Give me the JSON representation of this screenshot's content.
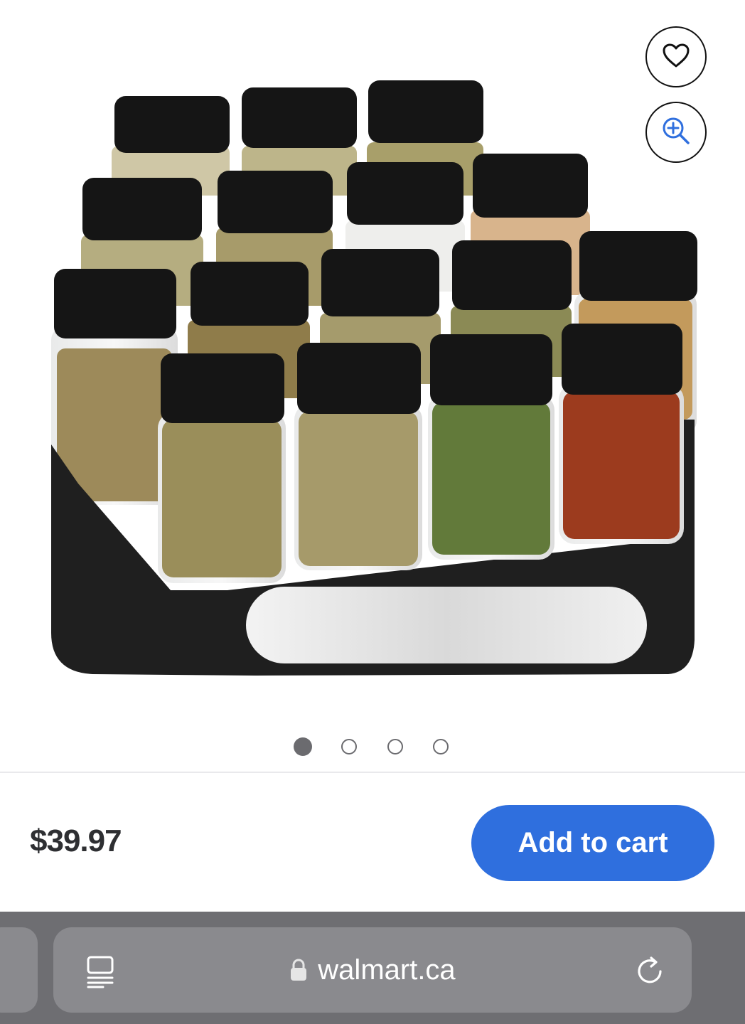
{
  "product": {
    "price": "$39.97",
    "add_to_cart_label": "Add to cart",
    "image_alt": "Spice rack with 16 glass spice jars with black lids",
    "carousel": {
      "total": 4,
      "active_index": 0
    }
  },
  "icons": {
    "favorite": "heart-icon",
    "zoom": "zoom-in-icon",
    "reader": "reader-mode-icon",
    "lock": "lock-icon",
    "reload": "reload-icon"
  },
  "browser": {
    "url": "walmart.ca"
  },
  "colors": {
    "accent": "#2f6fde",
    "price_text": "#2e2f32",
    "toolbar": "#6e6e72"
  }
}
